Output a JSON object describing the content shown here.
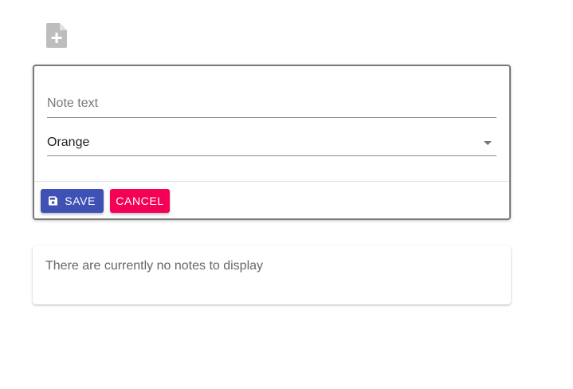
{
  "toolbar": {
    "add_note_icon": "note-add-icon"
  },
  "form": {
    "note_input": {
      "value": "",
      "placeholder": "Note text"
    },
    "color_select": {
      "selected": "Orange",
      "icon": "arrow-drop-down-icon"
    },
    "save_label": "Save",
    "save_icon": "save-icon",
    "cancel_label": "Cancel"
  },
  "notes": {
    "empty_message": "There are currently no notes to display"
  },
  "colors": {
    "primary": "#3f51b5",
    "secondary": "#f50057",
    "icon_gray": "#bdbdbd"
  }
}
